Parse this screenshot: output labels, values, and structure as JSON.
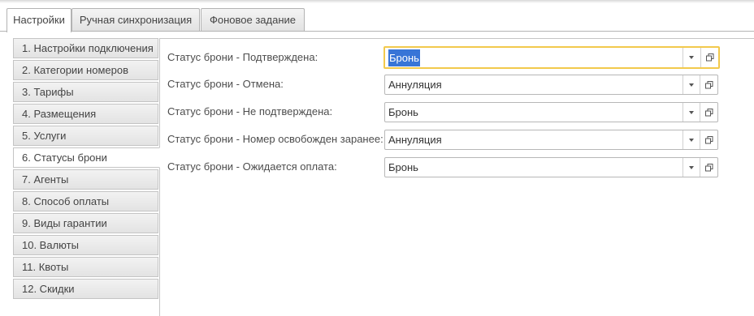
{
  "tabs": [
    {
      "label": "Настройки",
      "active": true
    },
    {
      "label": "Ручная синхронизация",
      "active": false
    },
    {
      "label": "Фоновое задание",
      "active": false
    }
  ],
  "sidebar": {
    "items": [
      {
        "label": "1. Настройки подключения"
      },
      {
        "label": "2. Категории номеров"
      },
      {
        "label": "3. Тарифы"
      },
      {
        "label": "4. Размещения"
      },
      {
        "label": "5. Услуги"
      },
      {
        "label": "6. Статусы брони",
        "active": true
      },
      {
        "label": "7. Агенты"
      },
      {
        "label": "8. Способ оплаты"
      },
      {
        "label": "9. Виды гарантии"
      },
      {
        "label": "10. Валюты"
      },
      {
        "label": "11. Квоты"
      },
      {
        "label": "12. Скидки"
      }
    ]
  },
  "form": {
    "rows": [
      {
        "label": "Статус брони - Подтверждена:",
        "value": "Бронь",
        "focused": true
      },
      {
        "label": "Статус брони - Отмена:",
        "value": "Аннуляция"
      },
      {
        "label": "Статус брони - Не подтверждена:",
        "value": "Бронь"
      },
      {
        "label": "Статус брони - Номер освобожден заранее:",
        "value": "Аннуляция"
      },
      {
        "label": "Статус брони - Ожидается оплата:",
        "value": "Бронь"
      }
    ]
  },
  "icons": {
    "dropdown": "chevron-down-icon",
    "open": "open-window-icon"
  },
  "colors": {
    "focus_border": "#f2c94c",
    "selection": "#3875d7"
  }
}
